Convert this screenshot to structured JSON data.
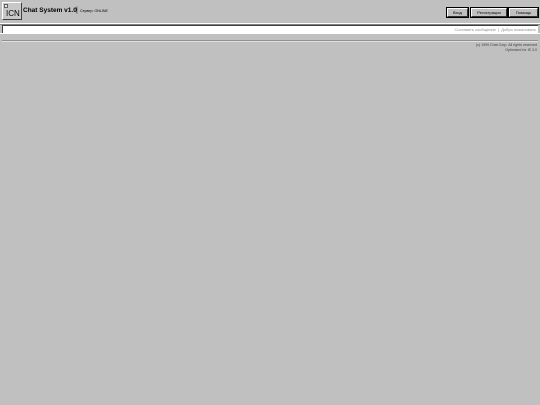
{
  "header": {
    "logo_text": "ICN",
    "app_title": "Chat System v1.0",
    "title_separator": "|",
    "server_label": "Сервер: ONLINE"
  },
  "buttons": {
    "login": "Вход",
    "register": "Регистрация",
    "help": "Помощь"
  },
  "status_bar": {
    "left": "Составить сообщение",
    "separator": "|",
    "right": "Добро пожаловать"
  },
  "footer": {
    "copyright": "(c) 1999 Chat Corp. All rights reserved",
    "optimized": "Optimized for IE 3.0"
  },
  "colors": {
    "background": "#c0c0c0",
    "status_text": "#909090"
  },
  "icons": {
    "logo": "icn-logo-icon"
  }
}
